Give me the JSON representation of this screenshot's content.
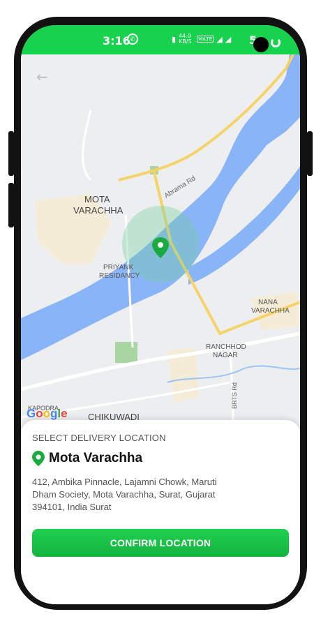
{
  "status_bar": {
    "time": "3:16",
    "network_speed": "44.0 KB/S",
    "network_type": "VoLTE",
    "battery": "5"
  },
  "map": {
    "labels": {
      "mota_varachha": "MOTA\nVARACHHA",
      "priyank": "PRIYANK\nRESIDANCY",
      "abrama": "Abrama Rd",
      "nana_varachha": "NANA\nVARACHHA",
      "ranchhod": "RANCHHOD\nNAGAR",
      "brts": "BRTS Rd",
      "kapodra": "KAPODRA",
      "chikuwadi": "CHIKUWADI"
    },
    "logo": "Google",
    "colors": {
      "water": "#8ab4f8",
      "road": "#f5d36a",
      "park": "#a8d5a2",
      "marker": "#1aab3e"
    }
  },
  "sheet": {
    "title": "SELECT DELIVERY LOCATION",
    "place_name": "Mota Varachha",
    "address": "412, Ambika Pinnacle, Lajamni Chowk, Maruti Dham Society, Mota Varachha, Surat, Gujarat 394101, India Surat",
    "confirm_label": "CONFIRM LOCATION"
  },
  "colors": {
    "accent": "#16d24d"
  }
}
